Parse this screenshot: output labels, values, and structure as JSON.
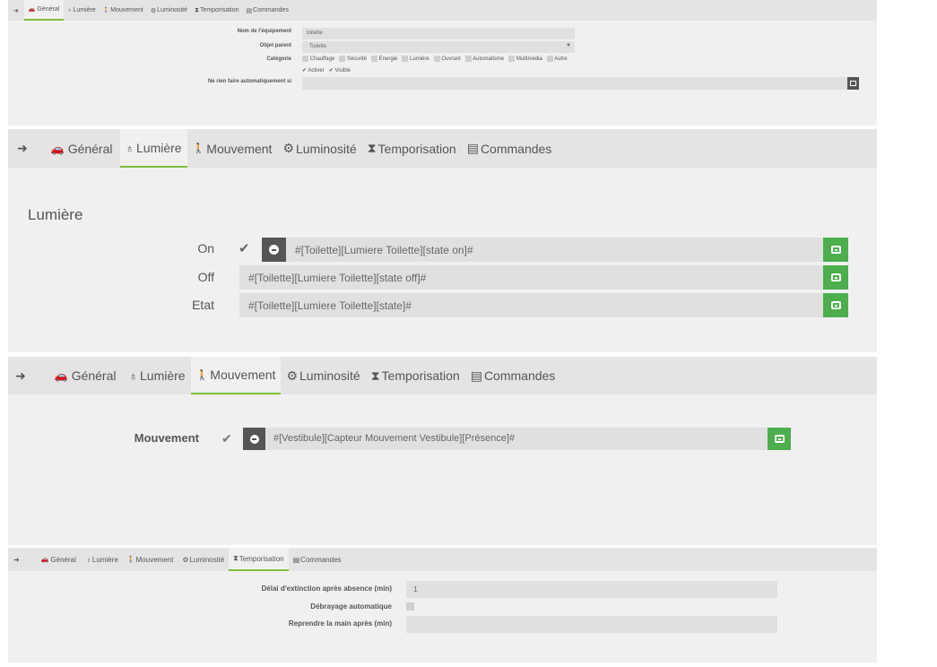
{
  "tabs": [
    {
      "icon": "back-icon",
      "glyph": "➜",
      "label": ""
    },
    {
      "icon": "dashboard-icon",
      "glyph": "🚗",
      "label": "Général"
    },
    {
      "icon": "lightbulb-icon",
      "glyph": "♁",
      "label": "Lumière"
    },
    {
      "icon": "person-icon",
      "glyph": "🚶",
      "label": "Mouvement"
    },
    {
      "icon": "sun-icon",
      "glyph": "⚙",
      "label": "Luminosité"
    },
    {
      "icon": "hourglass-icon",
      "glyph": "⧗",
      "label": "Temporisation"
    },
    {
      "icon": "list-icon",
      "glyph": "▤",
      "label": "Commandes"
    }
  ],
  "general": {
    "name_label": "Nom de l'équipement",
    "name_value": "toilette",
    "parent_label": "Objet parent",
    "parent_value": "Toilette",
    "category_label": "Catégorie",
    "categories": [
      "Chauffage",
      "Sécurité",
      "Energie",
      "Lumière",
      "Ouvrant",
      "Automatisme",
      "Multimédia",
      "Autre"
    ],
    "activate_label": "Activer",
    "visible_label": "Visible",
    "noauto_label": "Ne rien faire automatiquement si",
    "noauto_value": ""
  },
  "lumiere": {
    "heading": "Lumière",
    "rows": [
      {
        "label": "On",
        "value": "#[Toilette][Lumiere Toilette][state on]#"
      },
      {
        "label": "Off",
        "value": "#[Toilette][Lumiere Toilette][state off]#"
      },
      {
        "label": "Etat",
        "value": "#[Toilette][Lumiere Toilette][state]#"
      }
    ]
  },
  "mouvement": {
    "label": "Mouvement",
    "value": "#[Vestibule][Capteur Mouvement Vestibule][Présence]#"
  },
  "temporisation": {
    "delay_label": "Délai d'extinction après absence (min)",
    "delay_value": "1",
    "auto_label": "Débrayage automatique",
    "resume_label": "Reprendre la main après (min)",
    "resume_value": ""
  },
  "colors": {
    "accent": "#4cae4c",
    "active_tab_underline": "#7ebf3a",
    "tabbar": "#e4e4e4",
    "panel": "#f0f0f0"
  }
}
